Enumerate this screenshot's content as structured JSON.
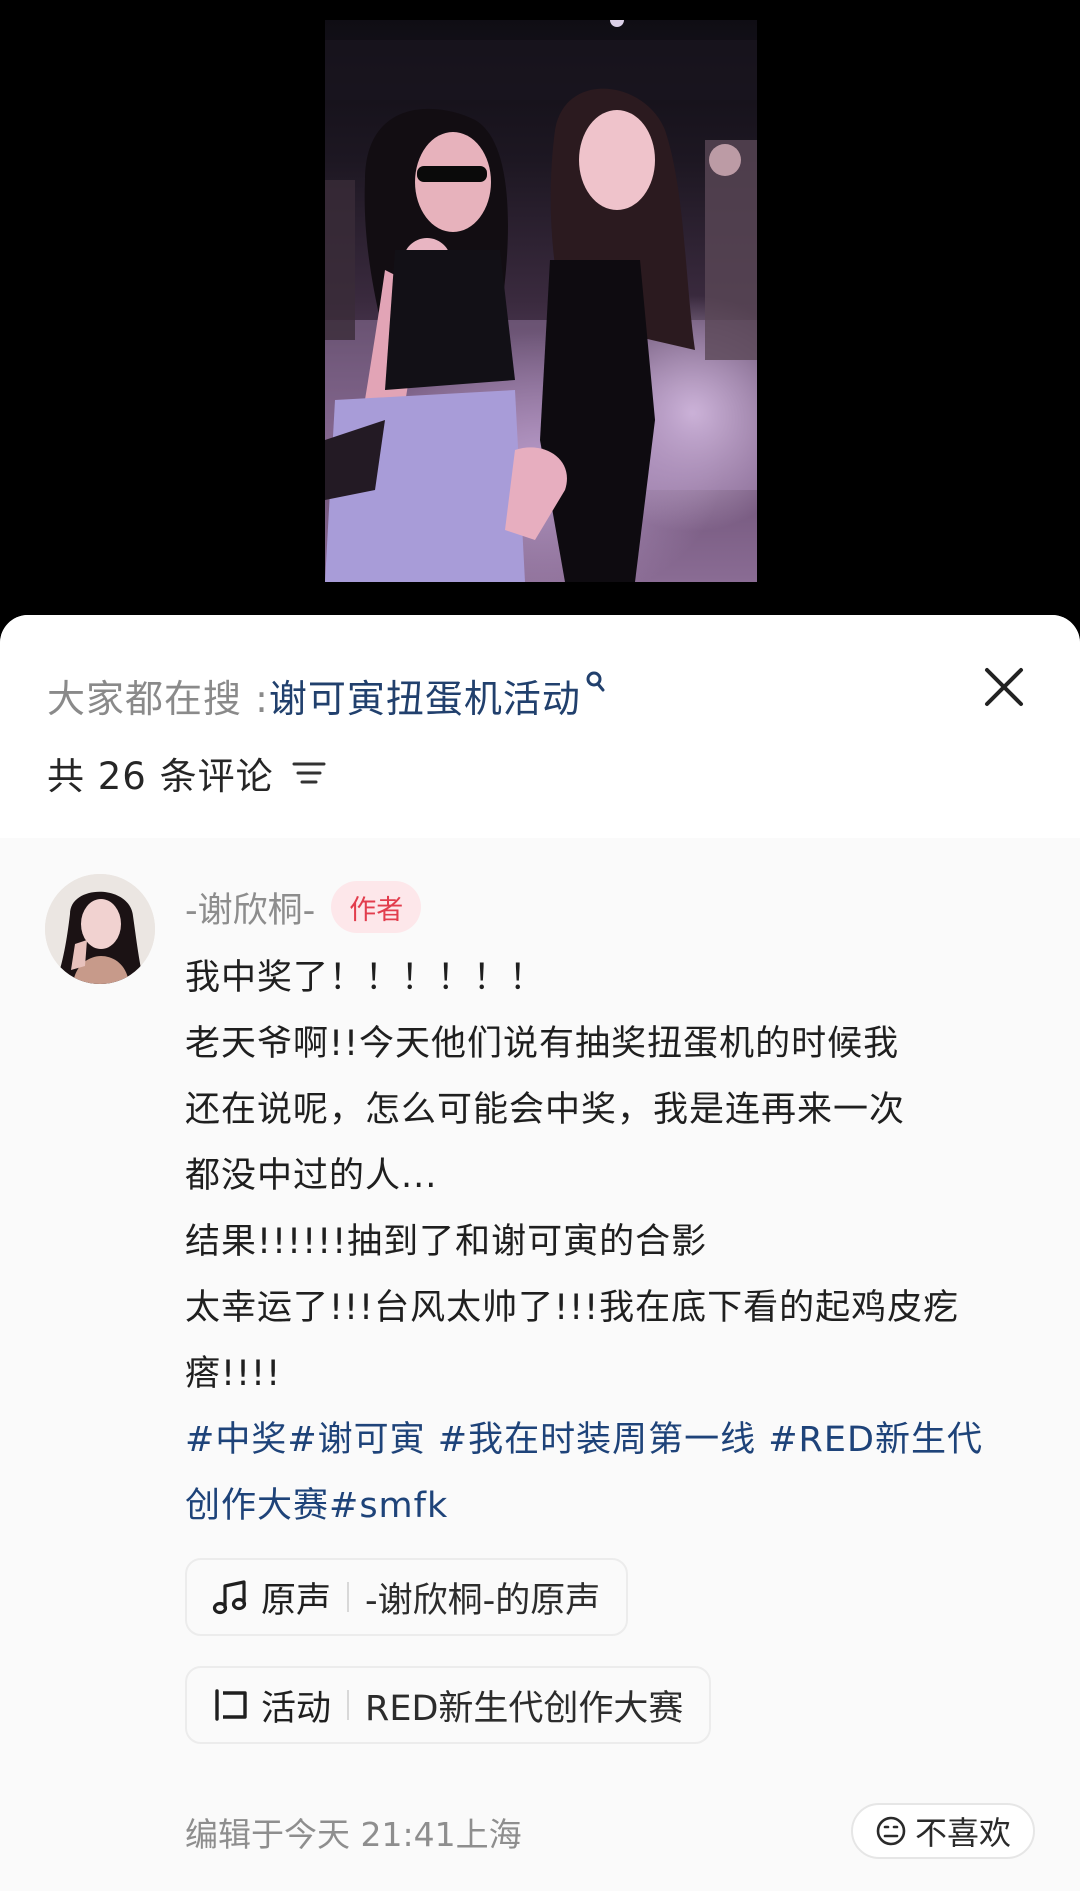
{
  "search": {
    "prefix": "大家都在搜 : ",
    "term": "谢可寅扭蛋机活动"
  },
  "comments_header": {
    "count_text": "共 26 条评论"
  },
  "comment": {
    "author": "-谢欣桐-",
    "badge": "作者",
    "lines": [
      "我中奖了！！！！！！",
      "老天爷啊!!今天他们说有抽奖扭蛋机的时候我",
      "还在说呢，怎么可能会中奖，我是连再来一次",
      "都没中过的人...",
      "结果!!!!!!抽到了和谢可寅的合影",
      "太幸运了!!!台风太帅了!!!我在底下看的起鸡皮疙",
      "瘩!!!!"
    ],
    "tags_line1": "#中奖#谢可寅 #我在时装周第一线 #RED新生代",
    "tags_line2": "创作大赛#smfk",
    "sound_chip": {
      "type": "原声",
      "value": "-谢欣桐-的原声"
    },
    "activity_chip": {
      "type": "活动",
      "value": "RED新生代创作大赛"
    },
    "meta": "编辑于今天 21:41上海",
    "dislike_label": "不喜欢"
  },
  "icons": {
    "search_mark": "search-icon",
    "close": "close-icon",
    "sort": "sort-icon",
    "sound": "music-note-icon",
    "activity": "activity-flag-icon",
    "dislike": "neutral-face-icon"
  },
  "colors": {
    "link": "#1e4379",
    "badge_bg": "#fde7ea",
    "badge_text": "#e23d4d",
    "muted": "#8d8d8d"
  }
}
